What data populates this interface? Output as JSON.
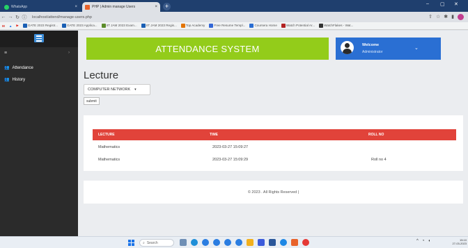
{
  "browser": {
    "tabs": [
      {
        "title": "WhatsApp",
        "active": false
      },
      {
        "title": "PHP | Admin manage Users",
        "active": false
      },
      {
        "title": "",
        "active": true
      }
    ],
    "new_tab_label": "+",
    "url": "localhost/attend/manage-users.php",
    "bookmarks": [
      "GATE 2023 Registr...",
      "GATE 2023 Applica...",
      "IIT JAM 2023 Exam...",
      "IIT JAM 2023 Regis...",
      "Top Academy",
      "Free Resume Templ...",
      "Coursera Home",
      "Watch Potential Ar...",
      "WatchFlakes - Wat..."
    ]
  },
  "sidebar": {
    "items": [
      {
        "label": "Attendance"
      },
      {
        "label": "History"
      }
    ]
  },
  "header": {
    "title": "ATTENDANCE SYSTEM",
    "welcome": "Welcome",
    "role": "Administrator"
  },
  "main": {
    "heading": "Lecture",
    "subject_select": {
      "selected": "COMPUTER NETWORK"
    },
    "submit_label": "submit",
    "table": {
      "columns": [
        "LECTURE",
        "TIME",
        "ROLL NO"
      ],
      "rows": [
        [
          "Mathematics",
          "2023-03-27 15:09:27",
          ""
        ],
        [
          "Mathematics",
          "2023-03-27 15:09:29",
          "Roll no 4"
        ]
      ]
    },
    "footer": "© 2023 . All Rights Reserved |"
  },
  "taskbar": {
    "search_label": "Search",
    "clock_time": "15:10",
    "clock_date": "27-03-2023"
  },
  "colors": {
    "banner": "#93cc1a",
    "welcome": "#2a6fd3",
    "table_header": "#e1433a",
    "sidebar": "#2b2b2b"
  }
}
